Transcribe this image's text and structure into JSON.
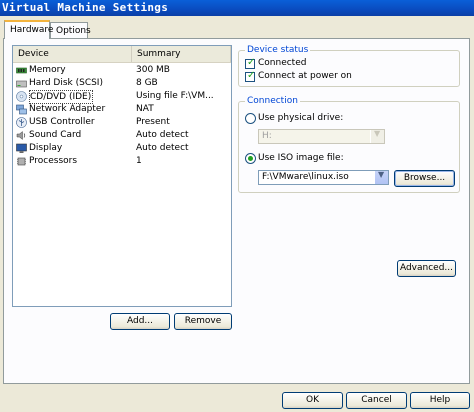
{
  "window": {
    "title": "Virtual Machine Settings"
  },
  "tabs": [
    {
      "label": "Hardware",
      "active": true
    },
    {
      "label": "Options",
      "active": false
    }
  ],
  "device_list": {
    "columns": [
      "Device",
      "Summary"
    ],
    "rows": [
      {
        "icon": "memory-icon",
        "name": "Memory",
        "summary": "300 MB"
      },
      {
        "icon": "hard-disk-icon",
        "name": "Hard Disk (SCSI)",
        "summary": "8 GB"
      },
      {
        "icon": "cd-dvd-icon",
        "name": "CD/DVD (IDE)",
        "summary": "Using file F:\\VM...",
        "selected": true
      },
      {
        "icon": "network-adapter-icon",
        "name": "Network Adapter",
        "summary": "NAT"
      },
      {
        "icon": "usb-icon",
        "name": "USB Controller",
        "summary": "Present"
      },
      {
        "icon": "sound-card-icon",
        "name": "Sound Card",
        "summary": "Auto detect"
      },
      {
        "icon": "display-icon",
        "name": "Display",
        "summary": "Auto detect"
      },
      {
        "icon": "processor-icon",
        "name": "Processors",
        "summary": "1"
      }
    ]
  },
  "buttons": {
    "add": "Add...",
    "remove": "Remove",
    "browse": "Browse...",
    "advanced": "Advanced...",
    "ok": "OK",
    "cancel": "Cancel",
    "help": "Help"
  },
  "device_status": {
    "label": "Device status",
    "connected": {
      "label": "Connected",
      "checked": true
    },
    "connect_at_power_on": {
      "label": "Connect at power on",
      "checked": true
    }
  },
  "connection": {
    "label": "Connection",
    "physical_drive": {
      "label": "Use physical drive:",
      "selected": false,
      "value": "H:"
    },
    "iso_image": {
      "label": "Use ISO image file:",
      "selected": true,
      "value": "F:\\VMware\\linux.iso"
    }
  },
  "colors": {
    "title_bar": "#0a4bbf",
    "group_label": "#0046d5",
    "check_mark": "#21a121"
  }
}
